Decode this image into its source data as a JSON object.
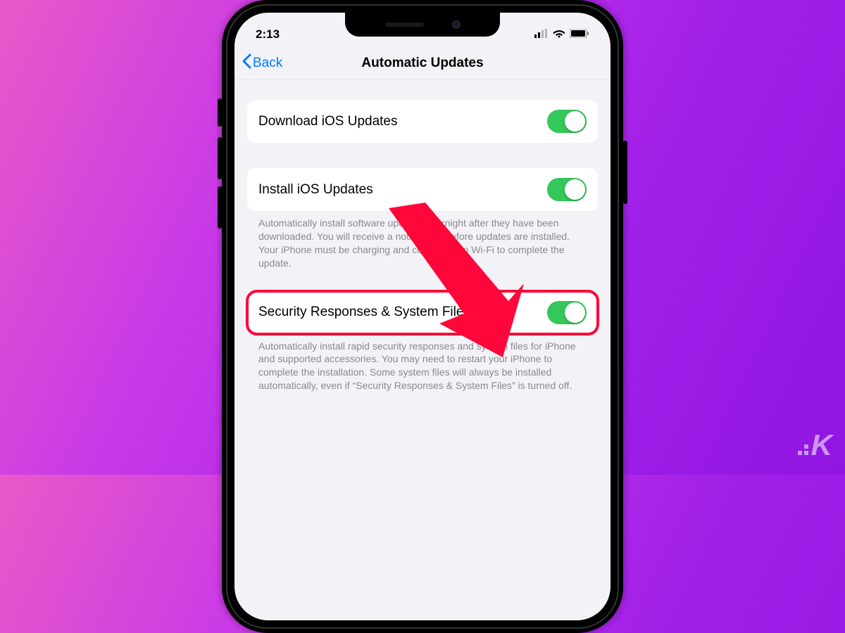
{
  "status": {
    "time": "2:13"
  },
  "nav": {
    "back_label": "Back",
    "title": "Automatic Updates"
  },
  "rows": {
    "download": {
      "label": "Download iOS Updates",
      "toggle_on": true
    },
    "install": {
      "label": "Install iOS Updates",
      "toggle_on": true,
      "footer": "Automatically install software updates overnight after they have been downloaded. You will receive a notification before updates are installed. Your iPhone must be charging and connected to Wi-Fi to complete the update."
    },
    "security": {
      "label": "Security Responses & System Files",
      "toggle_on": true,
      "footer": "Automatically install rapid security responses and system files for iPhone and supported accessories. You may need to restart your iPhone to complete the installation. Some system files will always be installed automatically, even if “Security Responses & System Files” is turned off."
    }
  },
  "watermark": "K"
}
